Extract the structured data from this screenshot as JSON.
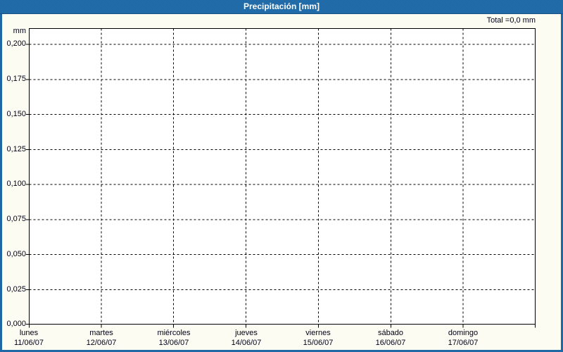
{
  "window": {
    "title": "Precipitación [mm]"
  },
  "colors": {
    "header_background": "#1e66a3",
    "frame_border": "#1e68a5",
    "page_background": "#fcfcf2",
    "plot_background": "#ffffff",
    "gridline": "#000000",
    "title_text": "#ffffff",
    "label_text": "#00001a"
  },
  "chart_data": {
    "type": "bar",
    "title": "Precipitación [mm]",
    "unit": "mm",
    "total_label": "Total =0,0 mm",
    "total_value_mm": 0.0,
    "categories": [
      "lunes",
      "martes",
      "miércoles",
      "jueves",
      "viernes",
      "sábado",
      "domingo"
    ],
    "dates": [
      "11/06/07",
      "12/06/07",
      "13/06/07",
      "14/06/07",
      "15/06/07",
      "16/06/07",
      "17/06/07"
    ],
    "values": [
      0,
      0,
      0,
      0,
      0,
      0,
      0
    ],
    "ylabel": "mm",
    "yticks": [
      "0,200",
      "0,175",
      "0,150",
      "0,125",
      "0,100",
      "0,075",
      "0,050",
      "0,025",
      "0,000"
    ],
    "ytick_values": [
      0.2,
      0.175,
      0.15,
      0.125,
      0.1,
      0.075,
      0.05,
      0.025,
      0.0
    ],
    "ylim": [
      0,
      0.2115
    ],
    "ystep": 0.025,
    "grid": "dashed",
    "legend": "none"
  }
}
